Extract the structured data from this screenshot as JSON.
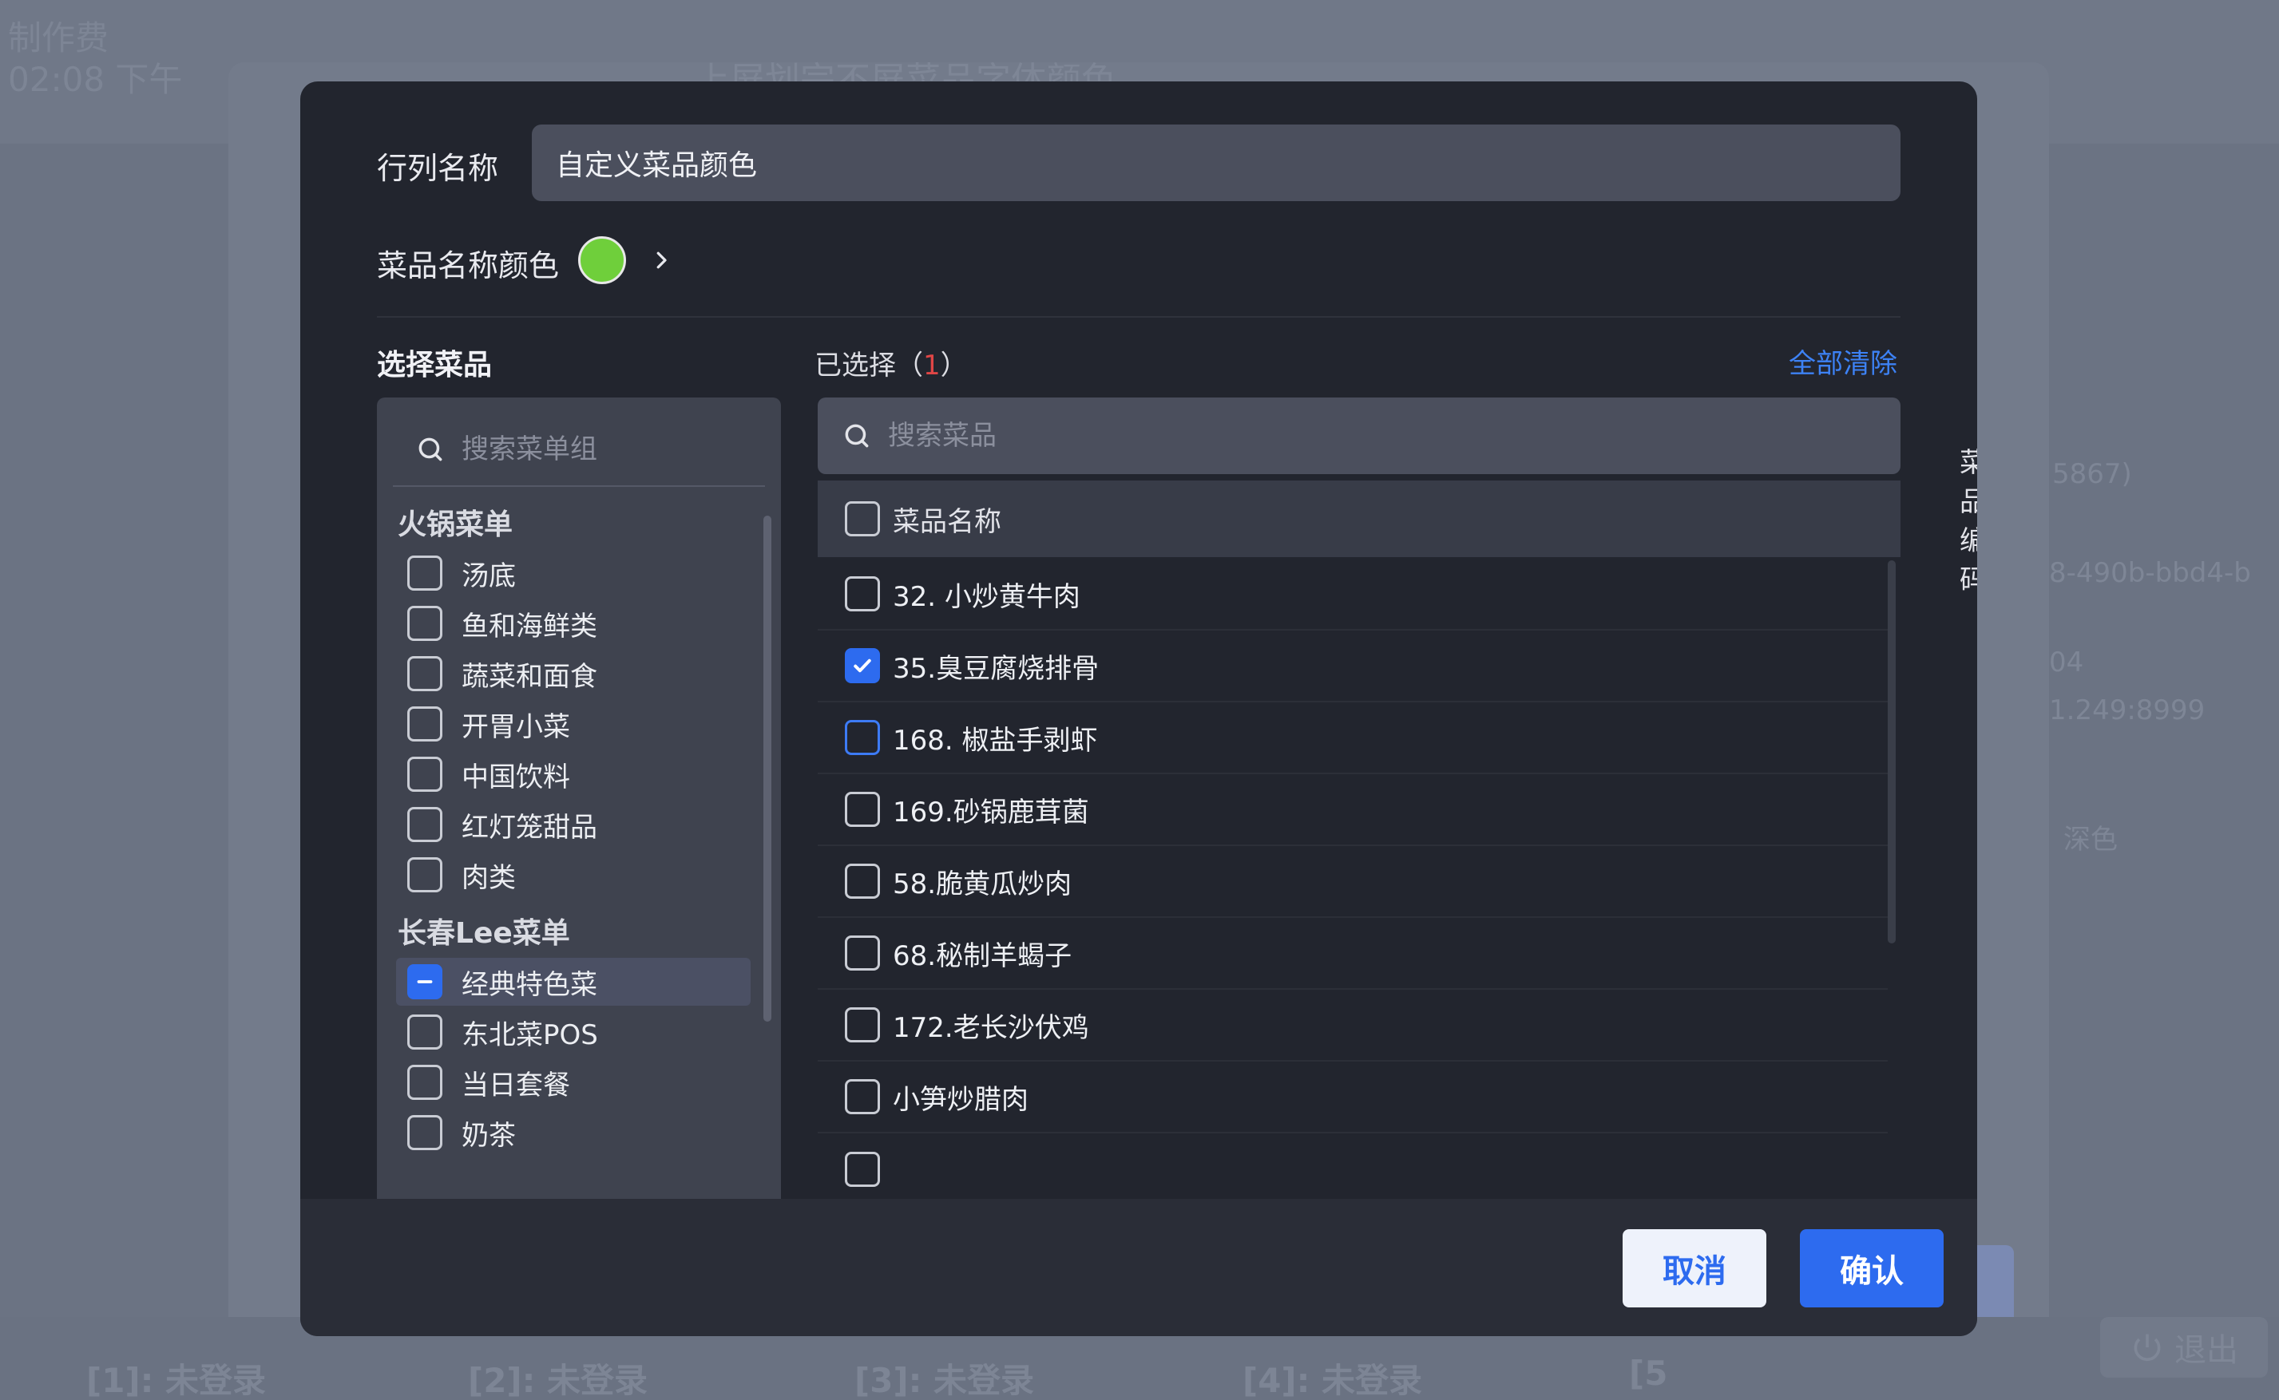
{
  "background": {
    "clock_label": "制作费",
    "clock_time": "02:08 下午",
    "ghost_title": "上屏划完不屏菜品字体颜色",
    "bottom_tabs": [
      "[1]: 未登录",
      "[2]: 未登录",
      "[3]: 未登录",
      "[4]: 未登录",
      "[5"
    ],
    "logout_label": "退出",
    "ghost_right": [
      "5867)",
      "8-490b-bbd4-b",
      "04",
      "1.249:8999",
      "深色"
    ]
  },
  "modal": {
    "row_name_label": "行列名称",
    "row_name_value": "自定义菜品颜色",
    "color_label": "菜品名称颜色",
    "color_value": "#6fcf3b",
    "select_title": "选择菜品",
    "selected_prefix": "已选择（",
    "selected_count": "1",
    "selected_suffix": "）",
    "clear_all": "全部清除",
    "left": {
      "search_placeholder": "搜索菜单组",
      "groups": [
        {
          "title": "火锅菜单",
          "items": [
            "汤底",
            "鱼和海鲜类",
            "蔬菜和面食",
            "开胃小菜",
            "中国饮料",
            "红灯笼甜品",
            "肉类"
          ]
        },
        {
          "title": "长春Lee菜单",
          "items": [
            "经典特色菜",
            "东北菜POS",
            "当日套餐",
            "奶茶"
          ]
        }
      ]
    },
    "right": {
      "search_placeholder": "搜索菜品",
      "col_name": "菜品名称",
      "col_code": "菜品编码",
      "rows": [
        "32. 小炒黄牛肉",
        "35.臭豆腐烧排骨",
        "168. 椒盐手剥虾",
        "169.砂锅鹿茸菌",
        "58.脆黄瓜炒肉",
        "68.秘制羊蝎子",
        "172.老长沙伏鸡",
        "小笋炒腊肉"
      ]
    },
    "cancel": "取消",
    "confirm": "确认"
  }
}
